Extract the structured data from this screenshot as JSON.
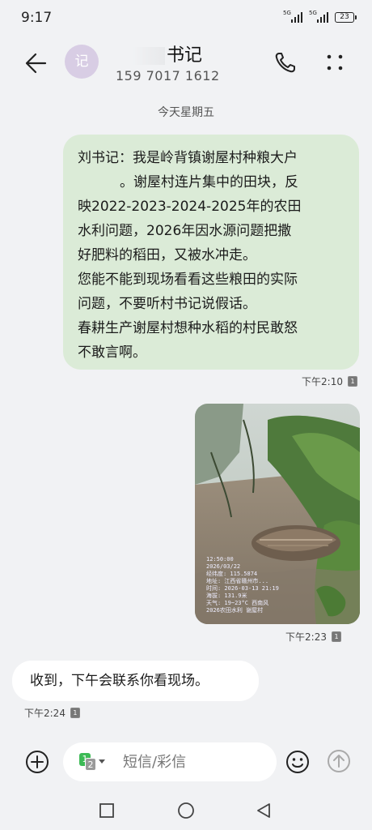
{
  "status_bar": {
    "time": "9:17",
    "network_1": "5G",
    "network_2": "5G",
    "battery": "23"
  },
  "header": {
    "avatar_text": "记",
    "contact_name": "书记",
    "contact_phone": "159 7017 1612"
  },
  "date_divider": "今天星期五",
  "messages": [
    {
      "direction": "outgoing",
      "lines": [
        "刘书记：我是岭背镇谢屋村种粮大户",
        "。谢屋村连片集中的田块，反",
        "映2022-2023-2024-2025年的农田",
        "水利问题，2026年因水源问题把撒",
        "好肥料的稻田，又被水冲走。",
        "您能不能到现场看看这些粮田的实际",
        "问题，不要听村书记说假话。",
        "春耕生产谢屋村想种水稻的村民敢怒",
        "不敢言啊。"
      ],
      "time": "下午2:10",
      "sim": "1"
    },
    {
      "direction": "outgoing",
      "type": "image",
      "overlay_lines": [
        "12:50:00",
        "2026/03/22",
        "经纬度: 115.5874",
        "地址: 江西省赣州市...",
        "时间: 2026-03-13 21:19",
        "海拔: 131.9米",
        "天气: 19~23°C 西南风",
        "2026农田水利 谢屋村"
      ],
      "time": "下午2:23",
      "sim": "1"
    },
    {
      "direction": "incoming",
      "text": "收到，下午会联系你看现场。",
      "time": "下午2:24",
      "sim": "1"
    }
  ],
  "composer": {
    "sim_primary": "1",
    "sim_secondary": "2",
    "placeholder": "短信/彩信"
  },
  "icons": {
    "back": "back-arrow-icon",
    "call": "phone-icon",
    "more": "more-dots-icon",
    "add": "add-circle-icon",
    "emoji": "emoji-icon",
    "send": "send-arrow-icon"
  }
}
